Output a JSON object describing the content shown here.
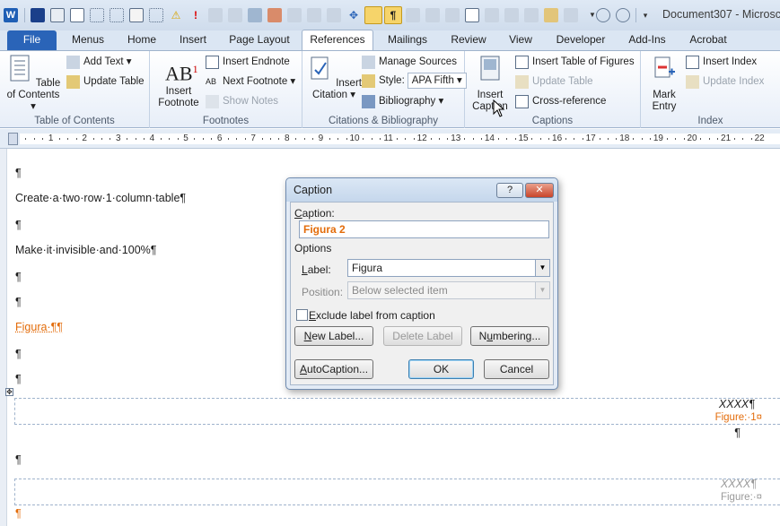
{
  "window": {
    "title": "Document307 - Microsc"
  },
  "tabs": [
    {
      "label": "File"
    },
    {
      "label": "Menus"
    },
    {
      "label": "Home"
    },
    {
      "label": "Insert"
    },
    {
      "label": "Page Layout"
    },
    {
      "label": "References"
    },
    {
      "label": "Mailings"
    },
    {
      "label": "Review"
    },
    {
      "label": "View"
    },
    {
      "label": "Developer"
    },
    {
      "label": "Add-Ins"
    },
    {
      "label": "Acrobat"
    }
  ],
  "ribbon": {
    "toc": {
      "title": "Table of Contents",
      "big_label": "Table of Contents",
      "add_text": "Add Text",
      "update_table": "Update Table"
    },
    "footnotes": {
      "title": "Footnotes",
      "insert_footnote": "Insert Footnote",
      "insert_endnote": "Insert Endnote",
      "next_footnote": "Next Footnote",
      "show_notes": "Show Notes"
    },
    "citations": {
      "title": "Citations & Bibliography",
      "insert_citation": "Insert Citation",
      "manage_sources": "Manage Sources",
      "style_label": "Style:",
      "style_value": "APA Fifth",
      "bibliography": "Bibliography"
    },
    "captions": {
      "title": "Captions",
      "insert_caption": "Insert Caption",
      "insert_tof": "Insert Table of Figures",
      "update_table": "Update Table",
      "cross_reference": "Cross-reference"
    },
    "index": {
      "title": "Index",
      "mark_entry": "Mark Entry",
      "insert_index": "Insert Index",
      "update_index": "Update Index"
    }
  },
  "ruler": {
    "numbers": [
      "1",
      "2",
      "3",
      "4",
      "5",
      "6",
      "7",
      "8",
      "9",
      "10",
      "11",
      "12",
      "13",
      "14",
      "15",
      "16",
      "17",
      "18",
      "19",
      "20",
      "21",
      "22"
    ]
  },
  "document": {
    "lines": [
      "¶",
      "Create·a·two·row·1·column·table¶",
      "¶",
      "Make·it·invisible·and·100%¶",
      "¶",
      "¶",
      "Figura·¶¶",
      "¶",
      "¶"
    ],
    "table1": {
      "text": "XXXX¶",
      "caption": "Figure:·1¤",
      "after": "¶"
    },
    "para_after": "¶",
    "table2": {
      "text": "XXXX¶",
      "caption": "Figure:·¤"
    },
    "last": "¶"
  },
  "dialog": {
    "title": "Caption",
    "help_btn": "?",
    "close_btn": "✕",
    "caption_label": "Caption:",
    "caption_value": "Figura 2",
    "options_label": "Options",
    "label_label": "Label:",
    "label_value": "Figura",
    "position_label": "Position:",
    "position_value": "Below selected item",
    "exclude_label": "Exclude label from caption",
    "new_label": "New Label...",
    "delete_label": "Delete Label",
    "numbering": "Numbering...",
    "autocaption": "AutoCaption...",
    "ok": "OK",
    "cancel": "Cancel"
  },
  "colors": {
    "accent": "#2a64b8",
    "orange": "#e36c0a"
  }
}
